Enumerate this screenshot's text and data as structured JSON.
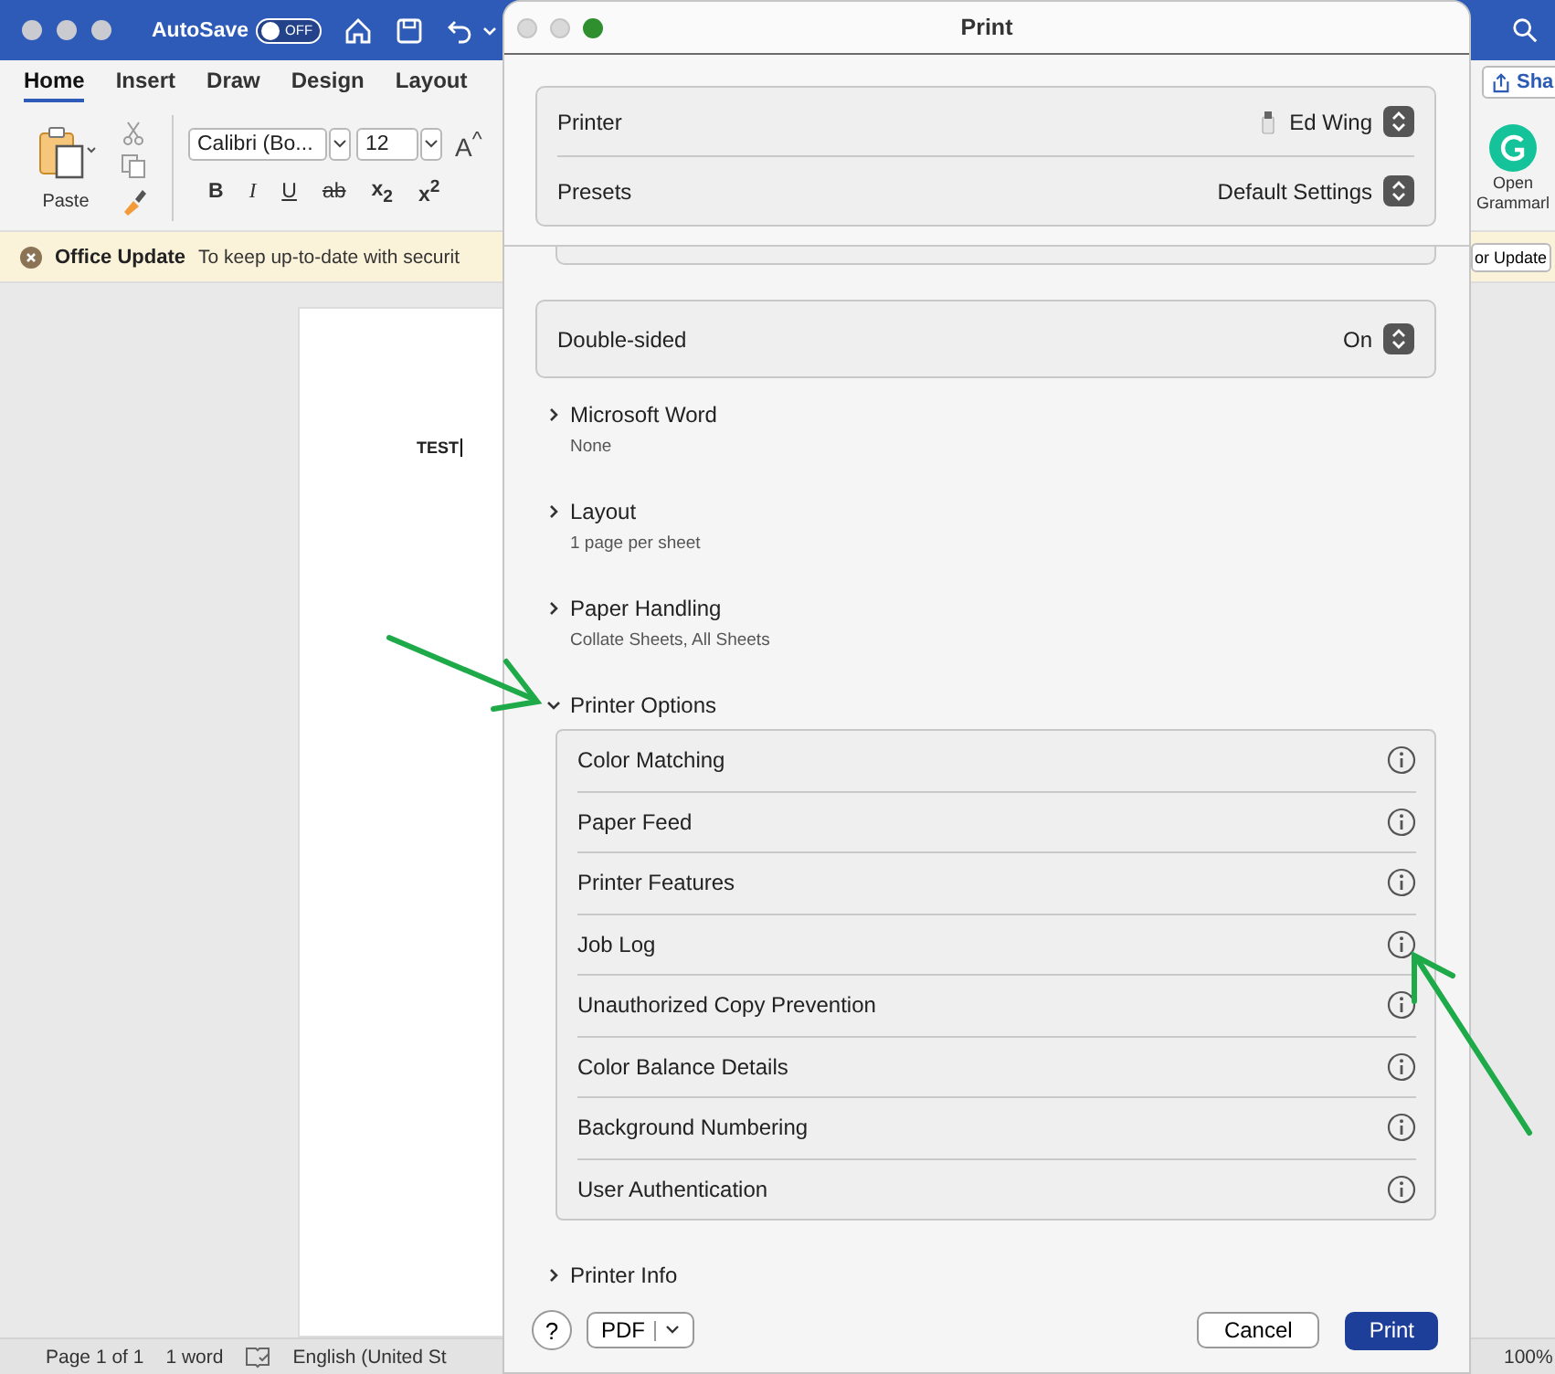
{
  "word": {
    "autosave": {
      "label": "AutoSave",
      "toggle_text": "OFF",
      "on": false
    },
    "tabs": [
      {
        "label": "Home",
        "selected": true
      },
      {
        "label": "Insert",
        "selected": false
      },
      {
        "label": "Draw",
        "selected": false
      },
      {
        "label": "Design",
        "selected": false
      },
      {
        "label": "Layout",
        "selected": false
      }
    ],
    "share": "Sha",
    "ribbon": {
      "paste": "Paste",
      "font": "Calibri (Bo...",
      "size": "12",
      "grow_font": "A$^{^}$",
      "format": [
        "B",
        "I",
        "U",
        "ab",
        "x$_{2}$",
        "x$^{2}$"
      ],
      "grammarly": [
        "Open",
        "Grammarl"
      ]
    },
    "notice": {
      "title": "Office Update",
      "text": "To keep up-to-date with securit",
      "right_text": "or Update"
    },
    "document": {
      "text": "TEST"
    },
    "status_bar": {
      "page": "Page 1 of 1",
      "words": "1 word",
      "language": "English (United St",
      "zoom": "100%"
    }
  },
  "print_dialog": {
    "title": "Print",
    "printer": {
      "label": "Printer",
      "value": "Ed Wing"
    },
    "presets": {
      "label": "Presets",
      "value": "Default Settings"
    },
    "double_sided": {
      "label": "Double-sided",
      "value": "On"
    },
    "sections": [
      {
        "title": "Microsoft Word",
        "summary": "None",
        "expanded": false
      },
      {
        "title": "Layout",
        "summary": "1 page per sheet",
        "expanded": false
      },
      {
        "title": "Paper Handling",
        "summary": "Collate Sheets, All Sheets",
        "expanded": false
      },
      {
        "title": "Printer Options",
        "expanded": true,
        "children": [
          "Color Matching",
          "Paper Feed",
          "Printer Features",
          "Job Log",
          "Unauthorized Copy Prevention",
          "Color Balance Details",
          "Background Numbering",
          "User Authentication"
        ]
      },
      {
        "title": "Printer Info",
        "expanded": false
      }
    ],
    "footer": {
      "help": "?",
      "pdf": "PDF",
      "cancel": "Cancel",
      "print": "Print"
    }
  }
}
